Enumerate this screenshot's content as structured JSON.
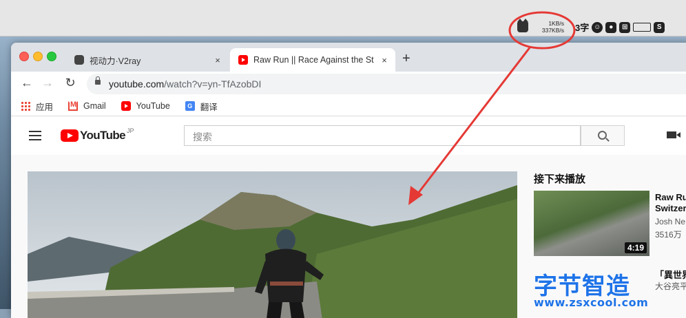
{
  "menubar": {
    "net_up": "1KB/s",
    "net_down": "337KB/s",
    "word_count": "3字",
    "tray_icons": [
      "emoji-icon",
      "mic-icon",
      "input-method-icon",
      "display-icon",
      "sogou-icon"
    ]
  },
  "browser": {
    "tabs": [
      {
        "title": "视动力·V2ray",
        "close": "×",
        "icon": "cat-icon",
        "active": false
      },
      {
        "title": "Raw Run || Race Against the St",
        "close": "×",
        "icon": "youtube-icon",
        "active": true
      }
    ],
    "new_tab": "+",
    "url_host": "youtube.com",
    "url_rest": "/watch?v=yn-TfAzobDI",
    "bookmarks": [
      {
        "label": "应用",
        "icon": "apps-icon"
      },
      {
        "label": "Gmail",
        "icon": "gmail-icon"
      },
      {
        "label": "YouTube",
        "icon": "youtube-icon"
      },
      {
        "label": "翻译",
        "icon": "translate-icon"
      }
    ]
  },
  "youtube": {
    "logo_text": "YouTube",
    "region": "JP",
    "search_placeholder": "搜索",
    "up_next": "接下来播放",
    "recommendations": [
      {
        "title": "Raw Ru",
        "title2": "Switzer",
        "channel": "Josh Ne",
        "views": "3516万",
        "duration": "4:19"
      },
      {
        "title": "「異世界",
        "channel": "大谷亮平"
      }
    ]
  },
  "watermark": {
    "text": "字节智造",
    "domain": "www.zsxcool.com"
  },
  "colors": {
    "youtube_red": "#ff0000",
    "annotation_red": "#e53935",
    "watermark_blue": "#1e73e8"
  }
}
